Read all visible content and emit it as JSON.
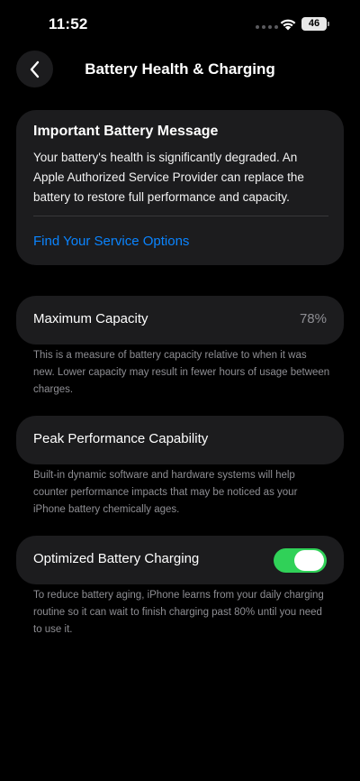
{
  "status_bar": {
    "time": "11:52",
    "battery_level": "46"
  },
  "nav": {
    "title": "Battery Health & Charging"
  },
  "message_card": {
    "title": "Important Battery Message",
    "body": "Your battery's health is significantly degraded. An Apple Authorized Service Provider can replace the battery to restore full performance and capacity.",
    "link": "Find Your Service Options"
  },
  "capacity": {
    "label": "Maximum Capacity",
    "value": "78%",
    "footnote": "This is a measure of battery capacity relative to when it was new. Lower capacity may result in fewer hours of usage between charges."
  },
  "peak": {
    "label": "Peak Performance Capability",
    "footnote": "Built-in dynamic software and hardware systems will help counter performance impacts that may be noticed as your iPhone battery chemically ages."
  },
  "optimized": {
    "label": "Optimized Battery Charging",
    "enabled": true,
    "footnote": "To reduce battery aging, iPhone learns from your daily charging routine so it can wait to finish charging past 80% until you need to use it."
  },
  "colors": {
    "accent": "#0a84ff",
    "toggle_on": "#30d158",
    "card": "#1c1c1e",
    "secondary_text": "#8e8e93"
  }
}
